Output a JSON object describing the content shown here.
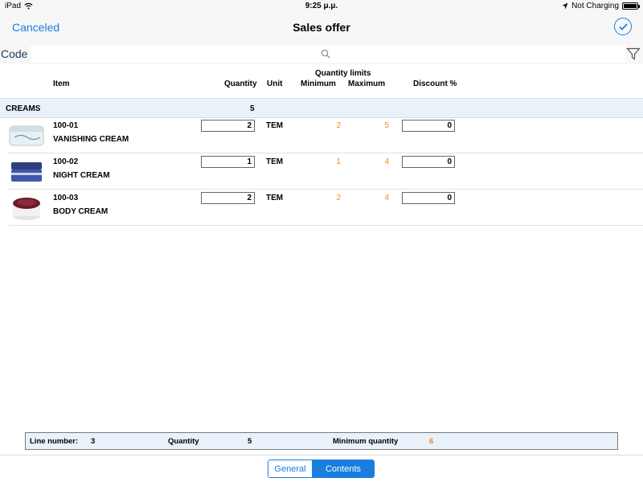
{
  "status": {
    "device": "iPad",
    "time": "9:25 μ.μ.",
    "charging": "Not Charging"
  },
  "nav": {
    "cancel_label": "Canceled",
    "title": "Sales offer"
  },
  "search": {
    "code_label": "Code",
    "placeholder": ""
  },
  "columns": {
    "item": "Item",
    "quantity": "Quantity",
    "unit": "Unit",
    "quantity_limits": "Quantity limits",
    "minimum": "Minimum",
    "maximum": "Maximum",
    "discount": "Discount %"
  },
  "group": {
    "name": "CREAMS",
    "quantity": "5"
  },
  "items": [
    {
      "code": "100-01",
      "name": "VANISHING CREAM",
      "quantity": "2",
      "unit": "TEM",
      "min": "2",
      "max": "5",
      "discount": "0"
    },
    {
      "code": "100-02",
      "name": "NIGHT CREAM",
      "quantity": "1",
      "unit": "TEM",
      "min": "1",
      "max": "4",
      "discount": "0"
    },
    {
      "code": "100-03",
      "name": "BODY CREAM",
      "quantity": "2",
      "unit": "TEM",
      "min": "2",
      "max": "4",
      "discount": "0"
    }
  ],
  "summary": {
    "line_number_label": "Line number:",
    "line_number_value": "3",
    "quantity_label": "Quantity",
    "quantity_value": "5",
    "min_qty_label": "Minimum quantity",
    "min_qty_value": "6"
  },
  "tabs": {
    "general": "General",
    "contents": "Contents"
  },
  "colors": {
    "accent": "#1a7ee0",
    "limit": "#f08a16",
    "group_bg": "#e9f1fb"
  }
}
